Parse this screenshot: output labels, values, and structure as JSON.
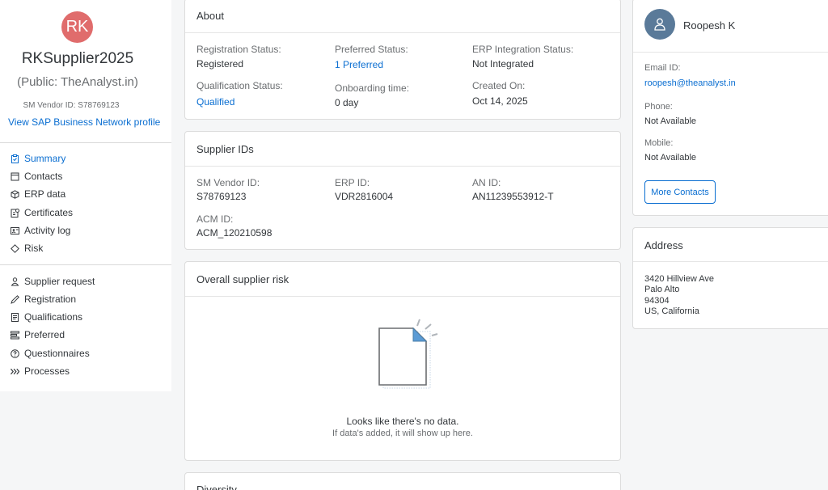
{
  "supplier": {
    "initials": "RK",
    "name": "RKSupplier2025",
    "public_name": "(Public: TheAnalyst.in)",
    "vendor_id_text": "SM Vendor ID:  S78769123",
    "profile_link": "View SAP Business Network profile",
    "avatar_color": "#e06c6c"
  },
  "nav": {
    "primary": [
      {
        "label": "Summary",
        "icon": "clipboard-icon",
        "active": true
      },
      {
        "label": "Contacts",
        "icon": "contacts-icon"
      },
      {
        "label": "ERP data",
        "icon": "cube-icon"
      },
      {
        "label": "Certificates",
        "icon": "certificate-icon"
      },
      {
        "label": "Activity log",
        "icon": "activity-log-icon"
      },
      {
        "label": "Risk",
        "icon": "diamond-icon"
      }
    ],
    "secondary": [
      {
        "label": "Supplier request",
        "icon": "supplier-request-icon"
      },
      {
        "label": "Registration",
        "icon": "pen-icon"
      },
      {
        "label": "Qualifications",
        "icon": "document-icon"
      },
      {
        "label": "Preferred",
        "icon": "list-icon"
      },
      {
        "label": "Questionnaires",
        "icon": "question-icon"
      },
      {
        "label": "Processes",
        "icon": "process-chevrons-icon"
      }
    ]
  },
  "about": {
    "title": "About",
    "registration_status_label": "Registration Status:",
    "registration_status_value": "Registered",
    "preferred_status_label": "Preferred Status:",
    "preferred_status_value": "1 Preferred",
    "erp_status_label": "ERP Integration Status:",
    "erp_status_value": "Not Integrated",
    "qualification_status_label": "Qualification Status:",
    "qualification_status_value": "Qualified",
    "onboarding_label": "Onboarding time:",
    "onboarding_value": "0 day",
    "created_label": "Created On:",
    "created_value": "Oct 14, 2025"
  },
  "supplier_ids": {
    "title": "Supplier IDs",
    "sm_vendor_label": "SM Vendor ID:",
    "sm_vendor_value": "S78769123",
    "erp_id_label": "ERP ID:",
    "erp_id_value": "VDR2816004",
    "an_id_label": "AN ID:",
    "an_id_value": "AN11239553912-T",
    "acm_id_label": "ACM ID:",
    "acm_id_value": "ACM_120210598"
  },
  "risk": {
    "title": "Overall supplier risk",
    "empty_title": "Looks like there's no data.",
    "empty_subtitle": "If data's added, it will show up here."
  },
  "diversity": {
    "title": "Diversity"
  },
  "contact": {
    "name": "Roopesh K",
    "email_label": "Email ID:",
    "email_value": "roopesh@theanalyst.in",
    "phone_label": "Phone:",
    "phone_value": "Not Available",
    "mobile_label": "Mobile:",
    "mobile_value": "Not Available",
    "more_contacts": "More Contacts"
  },
  "address": {
    "title": "Address",
    "line1": "3420 Hillview Ave",
    "line2": "Palo Alto",
    "line3": "94304",
    "line4": "US, California"
  },
  "colors": {
    "link": "#0a6ed1",
    "background": "#f5f6f7"
  }
}
